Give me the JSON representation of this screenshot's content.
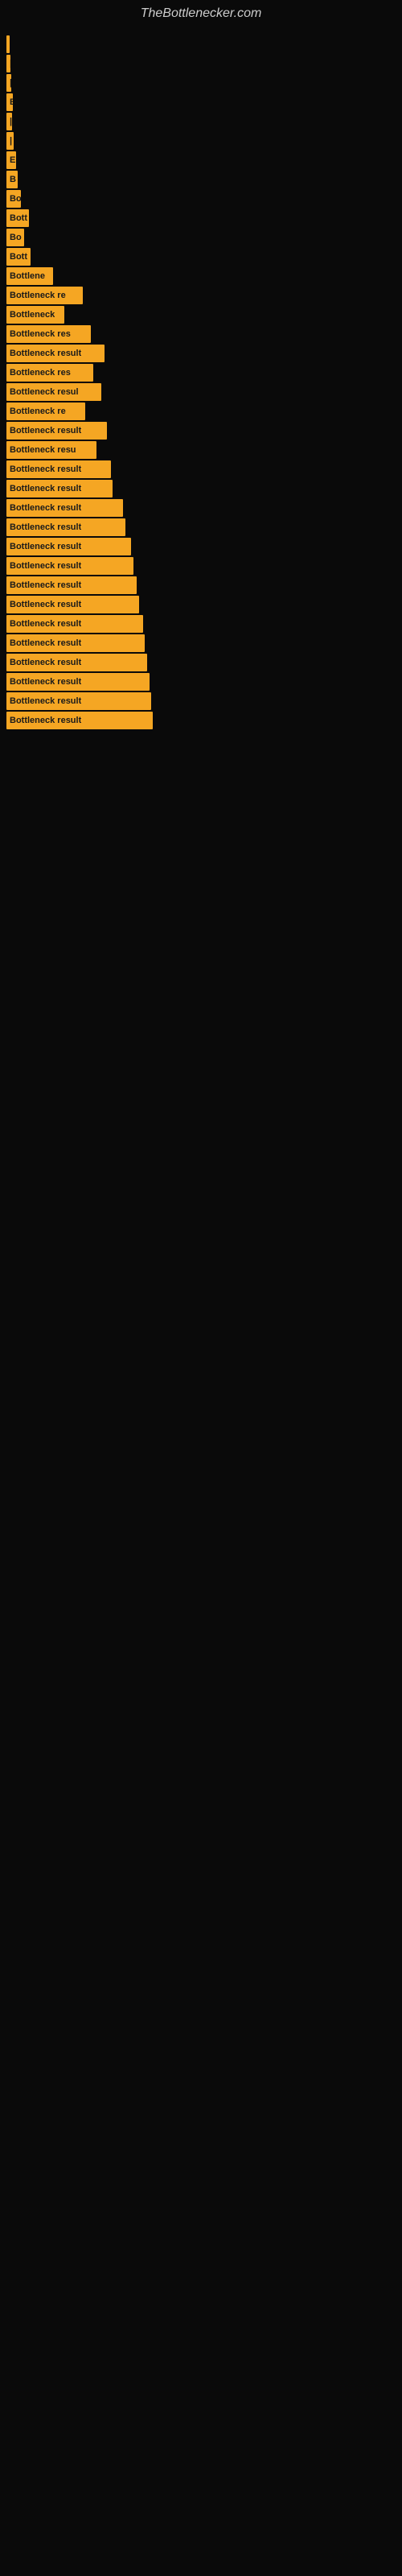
{
  "site": {
    "title": "TheBottlenecker.com"
  },
  "bars": [
    {
      "label": "|",
      "width": 4
    },
    {
      "label": "|",
      "width": 5
    },
    {
      "label": "|",
      "width": 6
    },
    {
      "label": "E",
      "width": 8
    },
    {
      "label": "|",
      "width": 7
    },
    {
      "label": "|",
      "width": 9
    },
    {
      "label": "E",
      "width": 12
    },
    {
      "label": "B",
      "width": 14
    },
    {
      "label": "Bo",
      "width": 18
    },
    {
      "label": "Bott",
      "width": 28
    },
    {
      "label": "Bo",
      "width": 22
    },
    {
      "label": "Bott",
      "width": 30
    },
    {
      "label": "Bottlene",
      "width": 58
    },
    {
      "label": "Bottleneck re",
      "width": 95
    },
    {
      "label": "Bottleneck",
      "width": 72
    },
    {
      "label": "Bottleneck res",
      "width": 105
    },
    {
      "label": "Bottleneck result",
      "width": 122
    },
    {
      "label": "Bottleneck res",
      "width": 108
    },
    {
      "label": "Bottleneck resul",
      "width": 118
    },
    {
      "label": "Bottleneck re",
      "width": 98
    },
    {
      "label": "Bottleneck result",
      "width": 125
    },
    {
      "label": "Bottleneck resu",
      "width": 112
    },
    {
      "label": "Bottleneck result",
      "width": 130
    },
    {
      "label": "Bottleneck result",
      "width": 132
    },
    {
      "label": "Bottleneck result",
      "width": 145
    },
    {
      "label": "Bottleneck result",
      "width": 148
    },
    {
      "label": "Bottleneck result",
      "width": 155
    },
    {
      "label": "Bottleneck result",
      "width": 158
    },
    {
      "label": "Bottleneck result",
      "width": 162
    },
    {
      "label": "Bottleneck result",
      "width": 165
    },
    {
      "label": "Bottleneck result",
      "width": 170
    },
    {
      "label": "Bottleneck result",
      "width": 172
    },
    {
      "label": "Bottleneck result",
      "width": 175
    },
    {
      "label": "Bottleneck result",
      "width": 178
    },
    {
      "label": "Bottleneck result",
      "width": 180
    },
    {
      "label": "Bottleneck result",
      "width": 182
    }
  ]
}
